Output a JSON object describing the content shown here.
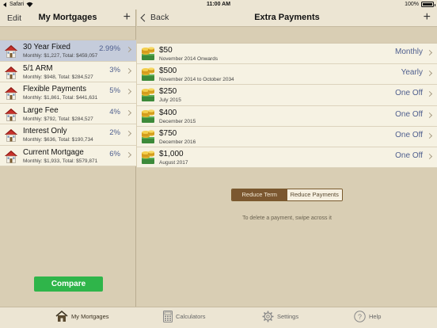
{
  "status_bar": {
    "carrier": "Safari",
    "time": "11:00 AM",
    "battery": "100%"
  },
  "left_nav": {
    "edit_label": "Edit",
    "title": "My Mortgages",
    "add_symbol": "+"
  },
  "mortgages": [
    {
      "name": "30 Year Fixed",
      "rate": "2.99%",
      "detail": "Monthly: $1,227, Total: $459,057",
      "selected": true
    },
    {
      "name": "5/1 ARM",
      "rate": "3%",
      "detail": "Monthly: $948, Total: $284,527",
      "selected": false
    },
    {
      "name": "Flexible Payments",
      "rate": "5%",
      "detail": "Monthly: $1,861, Total: $441,631",
      "selected": false
    },
    {
      "name": "Large Fee",
      "rate": "4%",
      "detail": "Monthly: $792, Total: $284,527",
      "selected": false
    },
    {
      "name": "Interest Only",
      "rate": "2%",
      "detail": "Monthly: $636, Total: $190,734",
      "selected": false
    },
    {
      "name": "Current Mortgage",
      "rate": "6%",
      "detail": "Monthly: $1,933, Total: $579,871",
      "selected": false
    }
  ],
  "compare_label": "Compare",
  "right_nav": {
    "back_label": "Back",
    "title": "Extra Payments",
    "add_symbol": "+"
  },
  "payments": [
    {
      "amount": "$50",
      "period": "November 2014 Onwards",
      "frequency": "Monthly"
    },
    {
      "amount": "$500",
      "period": "November 2014 to October 2034",
      "frequency": "Yearly"
    },
    {
      "amount": "$250",
      "period": "July 2015",
      "frequency": "One Off"
    },
    {
      "amount": "$400",
      "period": "December 2015",
      "frequency": "One Off"
    },
    {
      "amount": "$750",
      "period": "December 2016",
      "frequency": "One Off"
    },
    {
      "amount": "$1,000",
      "period": "August 2017",
      "frequency": "One Off"
    }
  ],
  "segmented": {
    "reduce_term": "Reduce Term",
    "reduce_payments": "Reduce Payments"
  },
  "hint": "To delete a payment, swipe across it",
  "tabs": [
    {
      "label": "My Mortgages",
      "icon": "house-icon"
    },
    {
      "label": "Calculators",
      "icon": "calculator-icon"
    },
    {
      "label": "Settings",
      "icon": "gear-icon"
    },
    {
      "label": "Help",
      "icon": "help-icon"
    }
  ],
  "colors": {
    "accent_blue": "#4f5f8e",
    "compare_green": "#2fb54a",
    "segment_active": "#7b5730"
  }
}
